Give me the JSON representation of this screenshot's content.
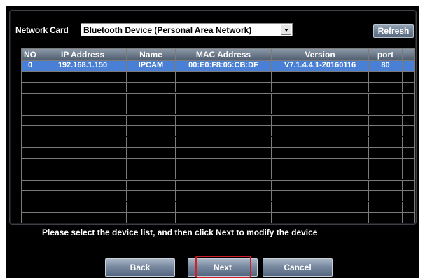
{
  "network_card": {
    "label": "Network Card",
    "selected": "Bluetooth Device (Personal Area Network)"
  },
  "refresh_label": "Refresh",
  "table": {
    "columns": [
      "NO",
      "IP Address",
      "Name",
      "MAC Address",
      "Version",
      "port"
    ],
    "rows": [
      {
        "no": "0",
        "ip": "192.168.1.150",
        "name": "IPCAM",
        "mac": "00:E0:F8:05:CB:DF",
        "version": "V7.1.4.4.1-20160116",
        "port": "80"
      }
    ]
  },
  "hint": "Please select the device list, and then click Next to modify the device",
  "buttons": {
    "back": "Back",
    "next": "Next",
    "cancel": "Cancel"
  },
  "colors": {
    "selected_row": "#4a7fd6",
    "next_highlight": "#d11f2a"
  }
}
